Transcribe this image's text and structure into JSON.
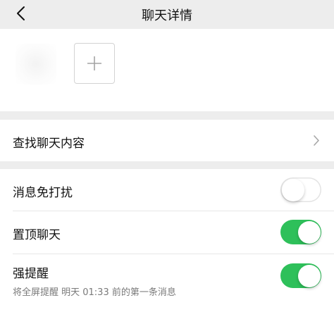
{
  "header": {
    "title": "聊天详情",
    "back_icon": "chevron-left-icon"
  },
  "members": {
    "add_icon": "plus-icon"
  },
  "search_row": {
    "label": "查找聊天内容",
    "icon": "chevron-right-icon"
  },
  "settings": {
    "mute": {
      "label": "消息免打扰",
      "enabled": false
    },
    "pin": {
      "label": "置顶聊天",
      "enabled": true
    },
    "strong_reminder": {
      "label": "强提醒",
      "sub_label": "将全屏提醒 明天 01:33 前的第一条消息",
      "enabled": true
    }
  },
  "colors": {
    "background": "#ededed",
    "toggle_on": "#2ec05a"
  }
}
